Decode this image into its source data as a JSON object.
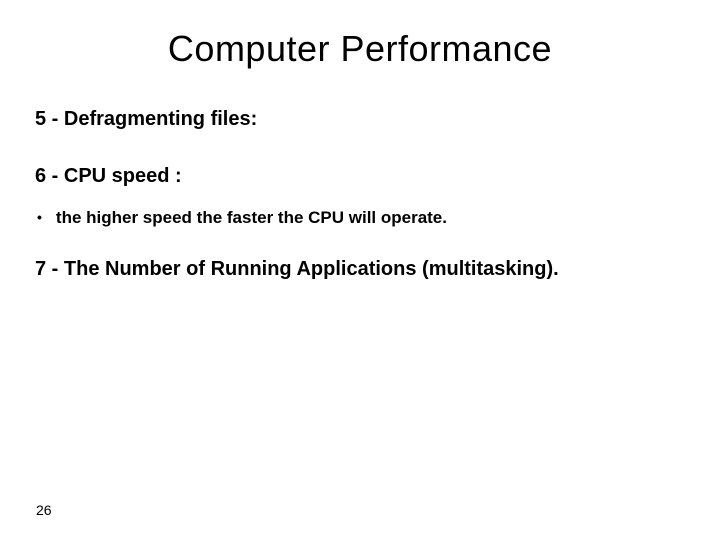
{
  "title": "Computer Performance",
  "items": {
    "item5": "5 - Defragmenting files:",
    "item6": "6 - CPU speed :",
    "item6_bullet": "the higher speed the faster the CPU will operate.",
    "item7": "7 - The Number of Running Applications (multitasking)."
  },
  "pageNumber": "26"
}
